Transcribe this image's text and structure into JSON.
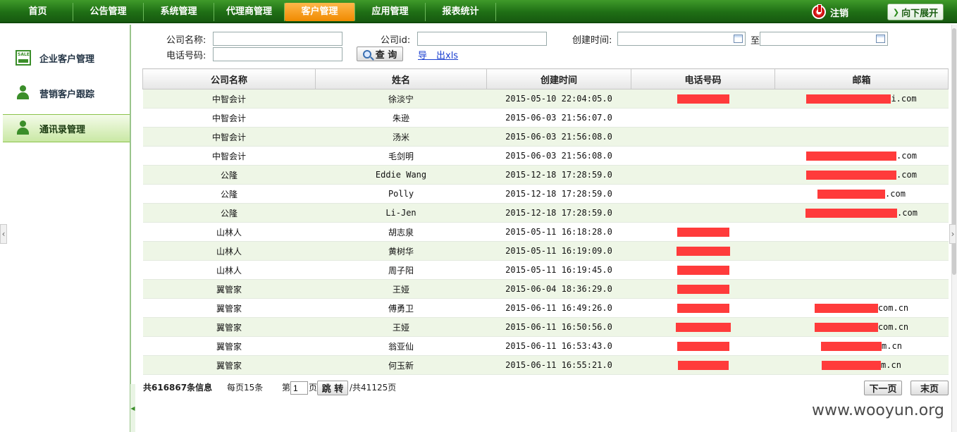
{
  "nav": {
    "items": [
      "首页",
      "公告管理",
      "系统管理",
      "代理商管理",
      "客户管理",
      "应用管理",
      "报表统计"
    ],
    "active": "客户管理",
    "logout": "注销",
    "expand": "向下展开"
  },
  "sidebar": {
    "items": [
      {
        "label": "企业客户管理",
        "icon": "sale-icon"
      },
      {
        "label": "营销客户跟踪",
        "icon": "user-icon"
      },
      {
        "label": "通讯录管理",
        "icon": "user-icon"
      }
    ],
    "active": "通讯录管理"
  },
  "search": {
    "company_name_label": "公司名称:",
    "company_id_label": "公司id:",
    "created_label": "创建时间:",
    "to_label": "至",
    "phone_label": "电话号码:",
    "query_button": "查 询",
    "export_link": "导　出xls"
  },
  "table": {
    "headers": [
      "公司名称",
      "姓名",
      "创建时间",
      "电话号码",
      "邮箱"
    ],
    "rows": [
      {
        "company": "中智会计",
        "name": "徐淡宁",
        "created": "2015-05-10 22:04:05.0",
        "phone_redacted": true,
        "email_suffix": "i.com"
      },
      {
        "company": "中智会计",
        "name": "朱逊",
        "created": "2015-06-03 21:56:07.0",
        "phone_redacted": false,
        "email_suffix": ""
      },
      {
        "company": "中智会计",
        "name": "汤米",
        "created": "2015-06-03 21:56:08.0",
        "phone_redacted": false,
        "email_suffix": ""
      },
      {
        "company": "中智会计",
        "name": "毛剑明",
        "created": "2015-06-03 21:56:08.0",
        "phone_redacted": false,
        "email_suffix": ".com"
      },
      {
        "company": "公隆",
        "name": "Eddie Wang",
        "created": "2015-12-18 17:28:59.0",
        "phone_redacted": false,
        "email_suffix": ".com"
      },
      {
        "company": "公隆",
        "name": "Polly",
        "created": "2015-12-18 17:28:59.0",
        "phone_redacted": false,
        "email_suffix": ".com"
      },
      {
        "company": "公隆",
        "name": "Li-Jen",
        "created": "2015-12-18 17:28:59.0",
        "phone_redacted": false,
        "email_suffix": ".com"
      },
      {
        "company": "山林人",
        "name": "胡志泉",
        "created": "2015-05-11 16:18:28.0",
        "phone_redacted": true,
        "email_suffix": ""
      },
      {
        "company": "山林人",
        "name": "黄树华",
        "created": "2015-05-11 16:19:09.0",
        "phone_redacted": true,
        "email_suffix": ""
      },
      {
        "company": "山林人",
        "name": "周子阳",
        "created": "2015-05-11 16:19:45.0",
        "phone_redacted": true,
        "email_suffix": ""
      },
      {
        "company": "翼管家",
        "name": "王娅",
        "created": "2015-06-04 18:36:29.0",
        "phone_redacted": true,
        "email_suffix": ""
      },
      {
        "company": "翼管家",
        "name": "傅勇卫",
        "created": "2015-06-11 16:49:26.0",
        "phone_redacted": true,
        "email_suffix": "com.cn"
      },
      {
        "company": "翼管家",
        "name": "王娅",
        "created": "2015-06-11 16:50:56.0",
        "phone_redacted": true,
        "email_suffix": "com.cn"
      },
      {
        "company": "翼管家",
        "name": "翁亚仙",
        "created": "2015-06-11 16:53:43.0",
        "phone_redacted": true,
        "email_suffix": "m.cn"
      },
      {
        "company": "翼管家",
        "name": "何玉新",
        "created": "2015-06-11 16:55:21.0",
        "phone_redacted": true,
        "email_suffix": "m.cn"
      }
    ]
  },
  "pager": {
    "total": "共616867条信息",
    "per_page": "每页15条",
    "page_prefix": "第",
    "page_value": "1",
    "page_suffix": "页",
    "jump": "跳 转",
    "total_pages": "/共41125页",
    "next": "下一页",
    "last": "末页"
  },
  "watermark": "www.wooyun.org",
  "colors": {
    "nav_green": "#1f6f15",
    "active_orange": "#f08a00",
    "row_alt": "#eef6e6",
    "redaction": "#ff3b3b"
  }
}
